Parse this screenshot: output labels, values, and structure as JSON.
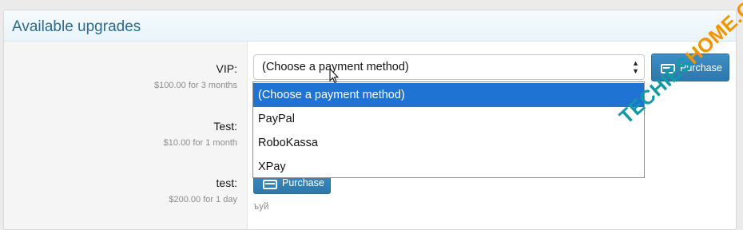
{
  "block": {
    "title": "Available upgrades"
  },
  "upgrades": [
    {
      "name": "VIP:",
      "price": "$100.00 for 3 months"
    },
    {
      "name": "Test:",
      "price": "$10.00 for 1 month"
    },
    {
      "name": "test:",
      "price": "$200.00 for 1 day"
    }
  ],
  "payment_select": {
    "value": "(Choose a payment method)",
    "options": [
      "(Choose a payment method)",
      "PayPal",
      "RoboKassa",
      "XPay"
    ],
    "selected_index": 0
  },
  "buttons": {
    "purchase": "Purchase"
  },
  "note": "ъуй",
  "watermark": {
    "part1": "TECHIES",
    "part2": "HOME.COM"
  },
  "colors": {
    "title": "#2d6b8e",
    "button": "#2f77ab",
    "highlight": "#1f73d2",
    "watermark_teal": "#0f9aa7",
    "watermark_orange": "#f29400"
  },
  "icons": {
    "purchase": "credit-card-icon",
    "select_arrow": "updown-arrows-icon",
    "cursor": "mouse-pointer-icon"
  }
}
